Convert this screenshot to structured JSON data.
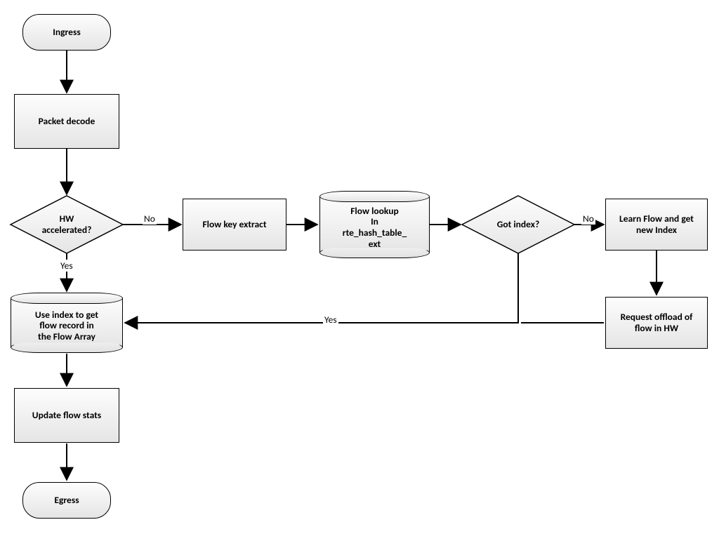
{
  "diagram": {
    "type": "flowchart",
    "nodes": {
      "ingress": {
        "shape": "terminator",
        "label": "Ingress"
      },
      "packet_decode": {
        "shape": "process",
        "label": "Packet decode"
      },
      "hw_accel": {
        "shape": "decision",
        "label": "HW\naccelerated?"
      },
      "flow_key": {
        "shape": "process",
        "label": "Flow key extract"
      },
      "flow_lookup": {
        "shape": "cylinder",
        "label": "Flow lookup\nIn\nrte_hash_table_\next"
      },
      "got_index": {
        "shape": "decision",
        "label": "Got index?"
      },
      "learn_flow": {
        "shape": "process",
        "label": "Learn Flow and get\nnew Index"
      },
      "req_offload": {
        "shape": "process",
        "label": "Request offload of\nflow in HW"
      },
      "use_index": {
        "shape": "cylinder",
        "label": "Use index to get\nflow record in\nthe Flow Array"
      },
      "update_stats": {
        "shape": "process",
        "label": "Update flow stats"
      },
      "egress": {
        "shape": "terminator",
        "label": "Egress"
      }
    },
    "edges": [
      {
        "from": "ingress",
        "to": "packet_decode",
        "label": ""
      },
      {
        "from": "packet_decode",
        "to": "hw_accel",
        "label": ""
      },
      {
        "from": "hw_accel",
        "to": "flow_key",
        "label": "No"
      },
      {
        "from": "hw_accel",
        "to": "use_index",
        "label": "Yes"
      },
      {
        "from": "flow_key",
        "to": "flow_lookup",
        "label": ""
      },
      {
        "from": "flow_lookup",
        "to": "got_index",
        "label": ""
      },
      {
        "from": "got_index",
        "to": "learn_flow",
        "label": "No"
      },
      {
        "from": "got_index",
        "to": "use_index",
        "label": "Yes"
      },
      {
        "from": "learn_flow",
        "to": "req_offload",
        "label": ""
      },
      {
        "from": "req_offload",
        "to": "use_index",
        "label": ""
      },
      {
        "from": "use_index",
        "to": "update_stats",
        "label": ""
      },
      {
        "from": "update_stats",
        "to": "egress",
        "label": ""
      }
    ],
    "edge_labels": {
      "hw_no": "No",
      "hw_yes": "Yes",
      "gi_no": "No",
      "gi_yes": "Yes"
    }
  }
}
